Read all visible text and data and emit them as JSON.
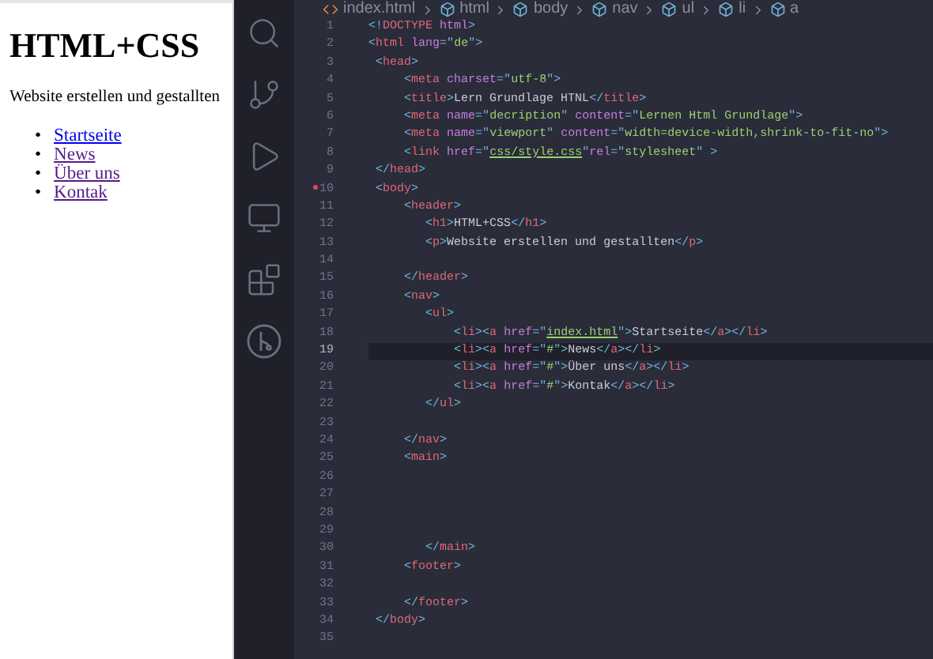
{
  "preview": {
    "heading": "HTML+CSS",
    "paragraph": "Website erstellen und gestallten",
    "links": [
      {
        "marker": "•",
        "text": "Startseite",
        "visited": false
      },
      {
        "marker": "•",
        "text": "News",
        "visited": true
      },
      {
        "marker": "•",
        "text": "Über uns",
        "visited": true
      },
      {
        "marker": "•",
        "text": "Kontak",
        "visited": true
      }
    ]
  },
  "breadcrumb": [
    {
      "kind": "file",
      "text": "index.html"
    },
    {
      "kind": "element",
      "text": "html"
    },
    {
      "kind": "element",
      "text": "body"
    },
    {
      "kind": "element",
      "text": "nav"
    },
    {
      "kind": "element",
      "text": "ul"
    },
    {
      "kind": "element",
      "text": "li"
    },
    {
      "kind": "element",
      "text": "a"
    }
  ],
  "editor": {
    "lines": [
      {
        "number": "1",
        "current": false,
        "marked": false,
        "tokens": [
          {
            "kind": "punct",
            "text": "<!"
          },
          {
            "kind": "tag",
            "text": "DOCTYPE"
          },
          {
            "kind": "attr",
            "text": " html"
          },
          {
            "kind": "punct",
            "text": ">"
          }
        ]
      },
      {
        "number": "2",
        "current": false,
        "marked": false,
        "tokens": [
          {
            "kind": "punct",
            "text": "<"
          },
          {
            "kind": "tag",
            "text": "html"
          },
          {
            "kind": "attr",
            "text": " lang"
          },
          {
            "kind": "punct",
            "text": "=\""
          },
          {
            "kind": "string",
            "text": "de"
          },
          {
            "kind": "punct",
            "text": "\">"
          }
        ]
      },
      {
        "number": "3",
        "current": false,
        "marked": false,
        "tokens": [
          {
            "kind": "punct",
            "text": " <"
          },
          {
            "kind": "tag",
            "text": "head"
          },
          {
            "kind": "punct",
            "text": ">"
          }
        ]
      },
      {
        "number": "4",
        "current": false,
        "marked": false,
        "tokens": [
          {
            "kind": "punct",
            "text": "     <"
          },
          {
            "kind": "tag",
            "text": "meta"
          },
          {
            "kind": "attr",
            "text": " charset"
          },
          {
            "kind": "punct",
            "text": "=\""
          },
          {
            "kind": "string",
            "text": "utf-8"
          },
          {
            "kind": "punct",
            "text": "\">"
          }
        ]
      },
      {
        "number": "5",
        "current": false,
        "marked": false,
        "tokens": [
          {
            "kind": "punct",
            "text": "     <"
          },
          {
            "kind": "tag",
            "text": "title"
          },
          {
            "kind": "punct",
            "text": ">"
          },
          {
            "kind": "text",
            "text": "Lern Grundlage HTNL"
          },
          {
            "kind": "punct",
            "text": "</"
          },
          {
            "kind": "tag",
            "text": "title"
          },
          {
            "kind": "punct",
            "text": ">"
          }
        ]
      },
      {
        "number": "6",
        "current": false,
        "marked": false,
        "tokens": [
          {
            "kind": "punct",
            "text": "     <"
          },
          {
            "kind": "tag",
            "text": "meta"
          },
          {
            "kind": "attr",
            "text": " name"
          },
          {
            "kind": "punct",
            "text": "=\""
          },
          {
            "kind": "string",
            "text": "decription"
          },
          {
            "kind": "punct",
            "text": "\" "
          },
          {
            "kind": "attr",
            "text": "content"
          },
          {
            "kind": "punct",
            "text": "=\""
          },
          {
            "kind": "string",
            "text": "Lernen Html Grundlage"
          },
          {
            "kind": "punct",
            "text": "\">"
          }
        ]
      },
      {
        "number": "7",
        "current": false,
        "marked": false,
        "tokens": [
          {
            "kind": "punct",
            "text": "     <"
          },
          {
            "kind": "tag",
            "text": "meta"
          },
          {
            "kind": "attr",
            "text": " name"
          },
          {
            "kind": "punct",
            "text": "=\""
          },
          {
            "kind": "string",
            "text": "viewport"
          },
          {
            "kind": "punct",
            "text": "\" "
          },
          {
            "kind": "attr",
            "text": "content"
          },
          {
            "kind": "punct",
            "text": "=\""
          },
          {
            "kind": "string",
            "text": "width=device-width,shrink-to-fit-no"
          },
          {
            "kind": "punct",
            "text": "\">"
          }
        ]
      },
      {
        "number": "8",
        "current": false,
        "marked": false,
        "tokens": [
          {
            "kind": "punct",
            "text": "     <"
          },
          {
            "kind": "tag",
            "text": "link"
          },
          {
            "kind": "attr",
            "text": " href"
          },
          {
            "kind": "punct",
            "text": "=\""
          },
          {
            "kind": "link",
            "text": "css/style.css"
          },
          {
            "kind": "punct",
            "text": "\""
          },
          {
            "kind": "attr",
            "text": "rel"
          },
          {
            "kind": "punct",
            "text": "=\""
          },
          {
            "kind": "string",
            "text": "stylesheet"
          },
          {
            "kind": "punct",
            "text": "\" >"
          }
        ]
      },
      {
        "number": "9",
        "current": false,
        "marked": false,
        "tokens": [
          {
            "kind": "punct",
            "text": " </"
          },
          {
            "kind": "tag",
            "text": "head"
          },
          {
            "kind": "punct",
            "text": ">"
          }
        ]
      },
      {
        "number": "10",
        "current": false,
        "marked": true,
        "tokens": [
          {
            "kind": "punct",
            "text": " <"
          },
          {
            "kind": "tag",
            "text": "body"
          },
          {
            "kind": "punct",
            "text": ">"
          }
        ]
      },
      {
        "number": "11",
        "current": false,
        "marked": false,
        "tokens": [
          {
            "kind": "punct",
            "text": "     <"
          },
          {
            "kind": "tag",
            "text": "header"
          },
          {
            "kind": "punct",
            "text": ">"
          }
        ]
      },
      {
        "number": "12",
        "current": false,
        "marked": false,
        "tokens": [
          {
            "kind": "punct",
            "text": "        <"
          },
          {
            "kind": "tag",
            "text": "h1"
          },
          {
            "kind": "punct",
            "text": ">"
          },
          {
            "kind": "text",
            "text": "HTML+CSS"
          },
          {
            "kind": "punct",
            "text": "</"
          },
          {
            "kind": "tag",
            "text": "h1"
          },
          {
            "kind": "punct",
            "text": ">"
          }
        ]
      },
      {
        "number": "13",
        "current": false,
        "marked": false,
        "tokens": [
          {
            "kind": "punct",
            "text": "        <"
          },
          {
            "kind": "tag",
            "text": "p"
          },
          {
            "kind": "punct",
            "text": ">"
          },
          {
            "kind": "text",
            "text": "Website erstellen und gestallten"
          },
          {
            "kind": "punct",
            "text": "</"
          },
          {
            "kind": "tag",
            "text": "p"
          },
          {
            "kind": "punct",
            "text": ">"
          }
        ]
      },
      {
        "number": "14",
        "current": false,
        "marked": false
      },
      {
        "number": "15",
        "current": false,
        "marked": false,
        "tokens": [
          {
            "kind": "punct",
            "text": "     </"
          },
          {
            "kind": "tag",
            "text": "header"
          },
          {
            "kind": "punct",
            "text": ">"
          }
        ]
      },
      {
        "number": "16",
        "current": false,
        "marked": false,
        "tokens": [
          {
            "kind": "punct",
            "text": "     <"
          },
          {
            "kind": "tag",
            "text": "nav"
          },
          {
            "kind": "punct",
            "text": ">"
          }
        ]
      },
      {
        "number": "17",
        "current": false,
        "marked": false,
        "tokens": [
          {
            "kind": "punct",
            "text": "        <"
          },
          {
            "kind": "tag",
            "text": "ul"
          },
          {
            "kind": "punct",
            "text": ">"
          }
        ]
      },
      {
        "number": "18",
        "current": false,
        "marked": false,
        "tokens": [
          {
            "kind": "punct",
            "text": "            <"
          },
          {
            "kind": "tag",
            "text": "li"
          },
          {
            "kind": "punct",
            "text": "><"
          },
          {
            "kind": "tag",
            "text": "a"
          },
          {
            "kind": "attr",
            "text": " href"
          },
          {
            "kind": "punct",
            "text": "=\""
          },
          {
            "kind": "link",
            "text": "index.html"
          },
          {
            "kind": "punct",
            "text": "\">"
          },
          {
            "kind": "text",
            "text": "Startseite"
          },
          {
            "kind": "punct",
            "text": "</"
          },
          {
            "kind": "tag",
            "text": "a"
          },
          {
            "kind": "punct",
            "text": "></"
          },
          {
            "kind": "tag",
            "text": "li"
          },
          {
            "kind": "punct",
            "text": ">"
          }
        ]
      },
      {
        "number": "19",
        "current": true,
        "marked": false,
        "tokens": [
          {
            "kind": "punct",
            "text": "            <"
          },
          {
            "kind": "tag",
            "text": "li"
          },
          {
            "kind": "punct",
            "text": "><"
          },
          {
            "kind": "tag",
            "text": "a"
          },
          {
            "kind": "attr",
            "text": " href"
          },
          {
            "kind": "punct",
            "text": "=\""
          },
          {
            "kind": "string",
            "text": "#"
          },
          {
            "kind": "punct",
            "text": "\">"
          },
          {
            "kind": "text",
            "text": "News"
          },
          {
            "kind": "punct",
            "text": "</"
          },
          {
            "kind": "tag",
            "text": "a"
          },
          {
            "kind": "punct",
            "text": "></"
          },
          {
            "kind": "tag",
            "text": "li"
          },
          {
            "kind": "punct",
            "text": ">"
          }
        ]
      },
      {
        "number": "20",
        "current": false,
        "marked": false,
        "tokens": [
          {
            "kind": "punct",
            "text": "            <"
          },
          {
            "kind": "tag",
            "text": "li"
          },
          {
            "kind": "punct",
            "text": "><"
          },
          {
            "kind": "tag",
            "text": "a"
          },
          {
            "kind": "attr",
            "text": " href"
          },
          {
            "kind": "punct",
            "text": "=\""
          },
          {
            "kind": "string",
            "text": "#"
          },
          {
            "kind": "punct",
            "text": "\">"
          },
          {
            "kind": "text",
            "text": "Über uns"
          },
          {
            "kind": "punct",
            "text": "</"
          },
          {
            "kind": "tag",
            "text": "a"
          },
          {
            "kind": "punct",
            "text": "></"
          },
          {
            "kind": "tag",
            "text": "li"
          },
          {
            "kind": "punct",
            "text": ">"
          }
        ]
      },
      {
        "number": "21",
        "current": false,
        "marked": false,
        "tokens": [
          {
            "kind": "punct",
            "text": "            <"
          },
          {
            "kind": "tag",
            "text": "li"
          },
          {
            "kind": "punct",
            "text": "><"
          },
          {
            "kind": "tag",
            "text": "a"
          },
          {
            "kind": "attr",
            "text": " href"
          },
          {
            "kind": "punct",
            "text": "=\""
          },
          {
            "kind": "string",
            "text": "#"
          },
          {
            "kind": "punct",
            "text": "\">"
          },
          {
            "kind": "text",
            "text": "Kontak"
          },
          {
            "kind": "punct",
            "text": "</"
          },
          {
            "kind": "tag",
            "text": "a"
          },
          {
            "kind": "punct",
            "text": "></"
          },
          {
            "kind": "tag",
            "text": "li"
          },
          {
            "kind": "punct",
            "text": ">"
          }
        ]
      },
      {
        "number": "22",
        "current": false,
        "marked": false,
        "tokens": [
          {
            "kind": "punct",
            "text": "        </"
          },
          {
            "kind": "tag",
            "text": "ul"
          },
          {
            "kind": "punct",
            "text": ">"
          }
        ]
      },
      {
        "number": "23",
        "current": false,
        "marked": false
      },
      {
        "number": "24",
        "current": false,
        "marked": false,
        "tokens": [
          {
            "kind": "punct",
            "text": "     </"
          },
          {
            "kind": "tag",
            "text": "nav"
          },
          {
            "kind": "punct",
            "text": ">"
          }
        ]
      },
      {
        "number": "25",
        "current": false,
        "marked": false,
        "tokens": [
          {
            "kind": "punct",
            "text": "     <"
          },
          {
            "kind": "tag",
            "text": "main"
          },
          {
            "kind": "punct",
            "text": ">"
          }
        ]
      },
      {
        "number": "26",
        "current": false,
        "marked": false
      },
      {
        "number": "27",
        "current": false,
        "marked": false
      },
      {
        "number": "28",
        "current": false,
        "marked": false
      },
      {
        "number": "29",
        "current": false,
        "marked": false
      },
      {
        "number": "30",
        "current": false,
        "marked": false,
        "tokens": [
          {
            "kind": "punct",
            "text": "        </"
          },
          {
            "kind": "tag",
            "text": "main"
          },
          {
            "kind": "punct",
            "text": ">"
          }
        ]
      },
      {
        "number": "31",
        "current": false,
        "marked": false,
        "tokens": [
          {
            "kind": "punct",
            "text": "     <"
          },
          {
            "kind": "tag",
            "text": "footer"
          },
          {
            "kind": "punct",
            "text": ">"
          }
        ]
      },
      {
        "number": "32",
        "current": false,
        "marked": false
      },
      {
        "number": "33",
        "current": false,
        "marked": false,
        "tokens": [
          {
            "kind": "punct",
            "text": "     </"
          },
          {
            "kind": "tag",
            "text": "footer"
          },
          {
            "kind": "punct",
            "text": ">"
          }
        ]
      },
      {
        "number": "34",
        "current": false,
        "marked": false,
        "tokens": [
          {
            "kind": "punct",
            "text": " </"
          },
          {
            "kind": "tag",
            "text": "body"
          },
          {
            "kind": "punct",
            "text": ">"
          }
        ]
      },
      {
        "number": "35",
        "current": false,
        "marked": false
      }
    ]
  }
}
